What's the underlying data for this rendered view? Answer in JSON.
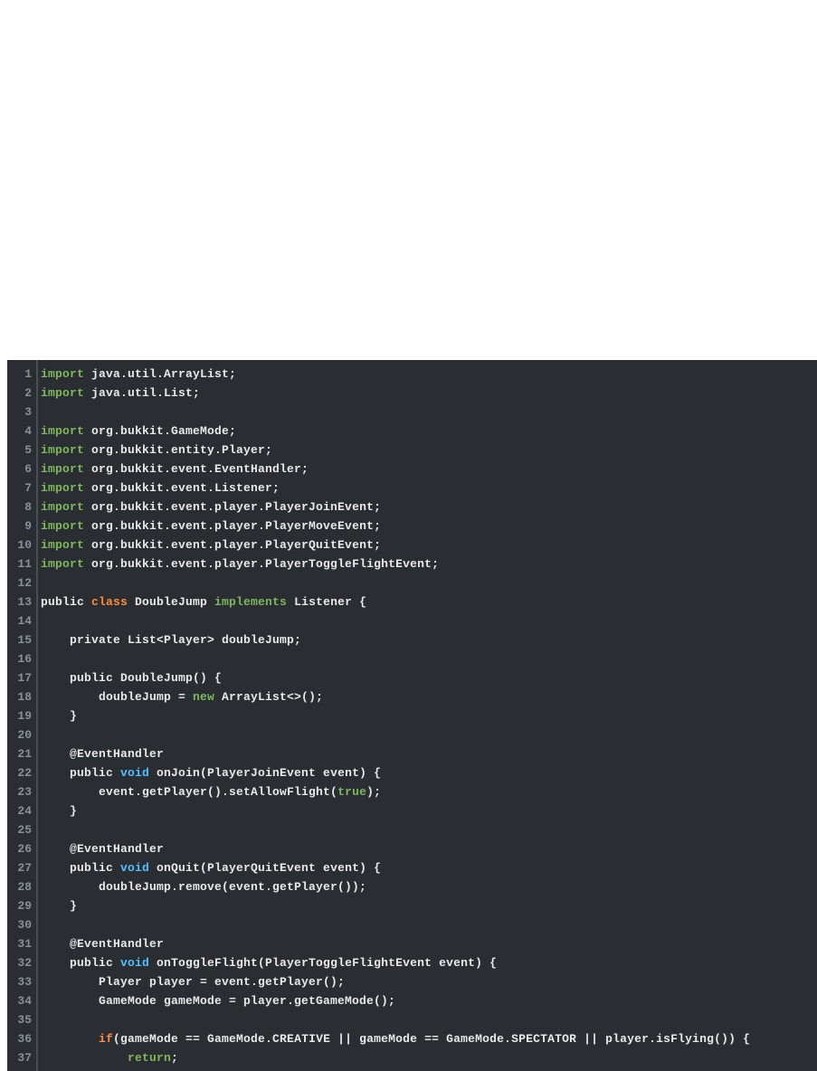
{
  "code": {
    "lines": [
      {
        "n": "1",
        "tokens": [
          [
            "import",
            "keyword2"
          ],
          [
            " java.util.ArrayList;",
            "plain"
          ]
        ]
      },
      {
        "n": "2",
        "tokens": [
          [
            "import",
            "keyword2"
          ],
          [
            " java.util.List;",
            "plain"
          ]
        ]
      },
      {
        "n": "3",
        "tokens": [
          [
            "",
            "plain"
          ]
        ]
      },
      {
        "n": "4",
        "tokens": [
          [
            "import",
            "keyword2"
          ],
          [
            " org.bukkit.GameMode;",
            "plain"
          ]
        ]
      },
      {
        "n": "5",
        "tokens": [
          [
            "import",
            "keyword2"
          ],
          [
            " org.bukkit.entity.Player;",
            "plain"
          ]
        ]
      },
      {
        "n": "6",
        "tokens": [
          [
            "import",
            "keyword2"
          ],
          [
            " org.bukkit.event.EventHandler;",
            "plain"
          ]
        ]
      },
      {
        "n": "7",
        "tokens": [
          [
            "import",
            "keyword2"
          ],
          [
            " org.bukkit.event.Listener;",
            "plain"
          ]
        ]
      },
      {
        "n": "8",
        "tokens": [
          [
            "import",
            "keyword2"
          ],
          [
            " org.bukkit.event.player.PlayerJoinEvent;",
            "plain"
          ]
        ]
      },
      {
        "n": "9",
        "tokens": [
          [
            "import",
            "keyword2"
          ],
          [
            " org.bukkit.event.player.PlayerMoveEvent;",
            "plain"
          ]
        ]
      },
      {
        "n": "10",
        "tokens": [
          [
            "import",
            "keyword2"
          ],
          [
            " org.bukkit.event.player.PlayerQuitEvent;",
            "plain"
          ]
        ]
      },
      {
        "n": "11",
        "tokens": [
          [
            "import",
            "keyword2"
          ],
          [
            " org.bukkit.event.player.PlayerToggleFlightEvent;",
            "plain"
          ]
        ]
      },
      {
        "n": "12",
        "tokens": [
          [
            "",
            "plain"
          ]
        ]
      },
      {
        "n": "13",
        "tokens": [
          [
            "public ",
            "plain"
          ],
          [
            "class",
            "keyword"
          ],
          [
            " DoubleJump ",
            "plain"
          ],
          [
            "implements",
            "keyword2"
          ],
          [
            " Listener {",
            "plain"
          ]
        ]
      },
      {
        "n": "14",
        "tokens": [
          [
            "",
            "plain"
          ]
        ]
      },
      {
        "n": "15",
        "tokens": [
          [
            "    private List<Player> doubleJump;",
            "plain"
          ]
        ]
      },
      {
        "n": "16",
        "tokens": [
          [
            "",
            "plain"
          ]
        ]
      },
      {
        "n": "17",
        "tokens": [
          [
            "    public DoubleJump() {",
            "plain"
          ]
        ]
      },
      {
        "n": "18",
        "tokens": [
          [
            "        doubleJump = ",
            "plain"
          ],
          [
            "new",
            "keyword2"
          ],
          [
            " ArrayList<>();",
            "plain"
          ]
        ]
      },
      {
        "n": "19",
        "tokens": [
          [
            "    }",
            "plain"
          ]
        ]
      },
      {
        "n": "20",
        "tokens": [
          [
            "",
            "plain"
          ]
        ]
      },
      {
        "n": "21",
        "tokens": [
          [
            "    @EventHandler",
            "plain"
          ]
        ]
      },
      {
        "n": "22",
        "tokens": [
          [
            "    public ",
            "plain"
          ],
          [
            "void",
            "type"
          ],
          [
            " onJoin(PlayerJoinEvent event) {",
            "plain"
          ]
        ]
      },
      {
        "n": "23",
        "tokens": [
          [
            "        event.getPlayer().setAllowFlight(",
            "plain"
          ],
          [
            "true",
            "literal"
          ],
          [
            ");",
            "plain"
          ]
        ]
      },
      {
        "n": "24",
        "tokens": [
          [
            "    }",
            "plain"
          ]
        ]
      },
      {
        "n": "25",
        "tokens": [
          [
            "",
            "plain"
          ]
        ]
      },
      {
        "n": "26",
        "tokens": [
          [
            "    @EventHandler",
            "plain"
          ]
        ]
      },
      {
        "n": "27",
        "tokens": [
          [
            "    public ",
            "plain"
          ],
          [
            "void",
            "type"
          ],
          [
            " onQuit(PlayerQuitEvent event) {",
            "plain"
          ]
        ]
      },
      {
        "n": "28",
        "tokens": [
          [
            "        doubleJump.remove(event.getPlayer());",
            "plain"
          ]
        ]
      },
      {
        "n": "29",
        "tokens": [
          [
            "    }",
            "plain"
          ]
        ]
      },
      {
        "n": "30",
        "tokens": [
          [
            "",
            "plain"
          ]
        ]
      },
      {
        "n": "31",
        "tokens": [
          [
            "    @EventHandler",
            "plain"
          ]
        ]
      },
      {
        "n": "32",
        "tokens": [
          [
            "    public ",
            "plain"
          ],
          [
            "void",
            "type"
          ],
          [
            " onToggleFlight(PlayerToggleFlightEvent event) {",
            "plain"
          ]
        ]
      },
      {
        "n": "33",
        "tokens": [
          [
            "        Player player = event.getPlayer();",
            "plain"
          ]
        ]
      },
      {
        "n": "34",
        "tokens": [
          [
            "        GameMode gameMode = player.getGameMode();",
            "plain"
          ]
        ]
      },
      {
        "n": "35",
        "tokens": [
          [
            "",
            "plain"
          ]
        ]
      },
      {
        "n": "36",
        "tokens": [
          [
            "        ",
            "plain"
          ],
          [
            "if",
            "keyword"
          ],
          [
            "(gameMode == GameMode.CREATIVE || gameMode == GameMode.SPECTATOR || player.isFlying()) {",
            "plain"
          ]
        ]
      },
      {
        "n": "37",
        "tokens": [
          [
            "            ",
            "plain"
          ],
          [
            "return",
            "keyword2"
          ],
          [
            ";",
            "plain"
          ]
        ]
      }
    ]
  }
}
